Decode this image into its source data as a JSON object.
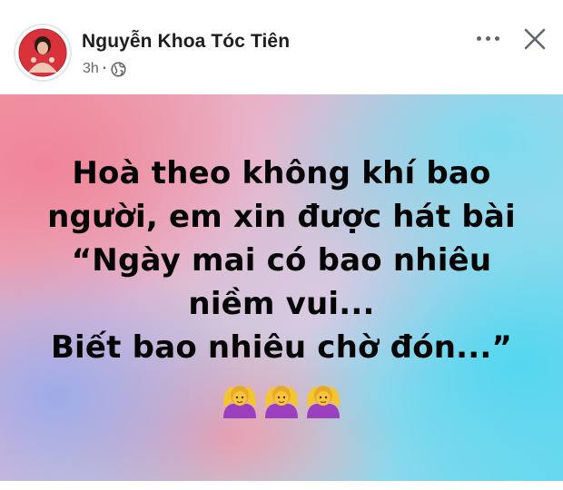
{
  "post": {
    "author": "Nguyễn Khoa Tóc Tiên",
    "time": "3h",
    "separator": "·",
    "privacy_icon": "globe-icon",
    "more_icon": "more-horizontal-icon",
    "close_icon": "close-icon",
    "avatar_icon": "avatar"
  },
  "status": {
    "lines": [
      "Hoà theo không khí bao",
      "người, em xin được hát bài",
      "“Ngày mai có bao nhiêu",
      "niềm vui...",
      "Biết bao nhiêu chờ đón...”"
    ],
    "emoji": [
      "🙆‍♀️",
      "🙆‍♀️",
      "🙆‍♀️"
    ]
  },
  "colors": {
    "author_text": "#1c1e21",
    "meta_text": "#65676b",
    "status_text": "#050505",
    "banner_pink": "#f09aa6",
    "banner_cyan": "#6fd8ee"
  }
}
